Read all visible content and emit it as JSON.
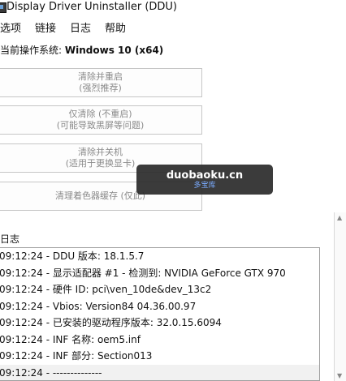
{
  "window": {
    "title": "Display Driver Uninstaller (DDU)"
  },
  "menu": [
    {
      "label": "选项"
    },
    {
      "label": "链接"
    },
    {
      "label": "日志"
    },
    {
      "label": "帮助"
    }
  ],
  "os": {
    "label": "当前操作系统:",
    "value": "Windows 10 (x64)"
  },
  "buttons": {
    "clean_restart": {
      "line1": "清除并重启",
      "line2": "(强烈推荐)"
    },
    "clean_only": {
      "line1": "仅清除 (不重启)",
      "line2": "(可能导致黑屏等问题)"
    },
    "clean_shutdown": {
      "line1": "清除并关机",
      "line2": "(适用于更换显卡)"
    },
    "clean_shader": {
      "line1": "清理着色器缓存 (仅此)"
    }
  },
  "log": {
    "label": "日志",
    "rows": [
      "09:12:24 - DDU 版本: 18.1.5.7",
      "09:12:24 - 显示适配器 #1 - 检测到: NVIDIA GeForce GTX 970",
      "09:12:24 - 硬件 ID: pci\\ven_10de&dev_13c2",
      "09:12:24 - Vbios: Version84 04.36.00.97",
      "09:12:24 - 已安装的驱动程序版本: 32.0.15.6094",
      "09:12:24 - INF 名称: oem5.inf",
      "09:12:24 - INF 部分: Section013",
      "09:12:24 - --------------"
    ]
  },
  "watermark": {
    "main": "duobaoku.cn",
    "sub": "多宝库"
  }
}
